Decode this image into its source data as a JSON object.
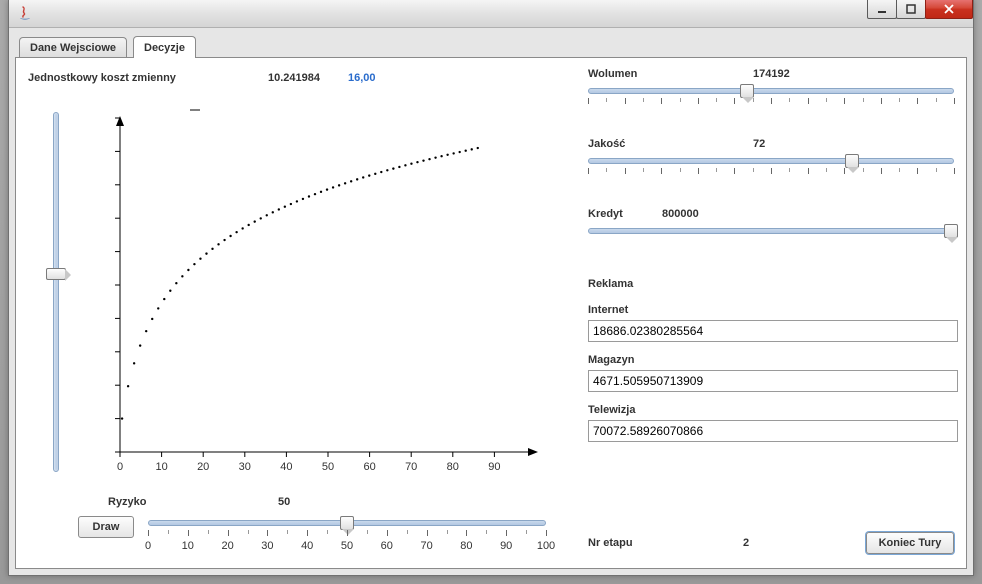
{
  "window": {
    "title": ""
  },
  "tabs": {
    "data_input": "Dane Wejsciowe",
    "decisions": "Decyzje",
    "active": 1
  },
  "cost": {
    "label": "Jednostkowy koszt zmienny",
    "value1": "10.241984",
    "value2": "16,00"
  },
  "vslider": {
    "min": 0,
    "max": 100,
    "value": 55
  },
  "ryzyko": {
    "label": "Ryzyko",
    "value": 50,
    "min": 0,
    "max": 100,
    "step_major": 10,
    "tick_labels": [
      "0",
      "10",
      "20",
      "30",
      "40",
      "50",
      "60",
      "70",
      "80",
      "90",
      "100"
    ]
  },
  "draw_label": "Draw",
  "wolumen": {
    "label": "Wolumen",
    "value": 174192,
    "min": 0,
    "max": 400000
  },
  "jakosc": {
    "label": "Jakość",
    "value": 72,
    "min": 0,
    "max": 100
  },
  "kredyt": {
    "label": "Kredyt",
    "value": 800000,
    "min": 0,
    "max": 800000
  },
  "reklama_label": "Reklama",
  "internet": {
    "label": "Internet",
    "value": "18686.02380285564"
  },
  "magazyn": {
    "label": "Magazyn",
    "value": "4671.505950713909"
  },
  "telewizja": {
    "label": "Telewizja",
    "value": "70072.58926070866"
  },
  "stage": {
    "label": "Nr etapu",
    "value": "2"
  },
  "end_turn_label": "Koniec Tury",
  "chart_data": {
    "type": "scatter",
    "title": "",
    "xlabel": "",
    "ylabel": "",
    "xlim": [
      0,
      100
    ],
    "ylim": [
      0,
      100
    ],
    "x_ticks": [
      0,
      10,
      20,
      30,
      40,
      50,
      60,
      70,
      80,
      90
    ],
    "series": [
      {
        "name": "curve",
        "x_start": 0.5,
        "x_end": 86,
        "n_points": 60,
        "y_at_0": 10,
        "y_at_100": 91,
        "shape": "log-like increasing, steep near 0 flattening after x≈50"
      }
    ],
    "note": "Points plotted as small black dots; y values estimated from pixel positions (no y-axis labels shown on screen)."
  }
}
